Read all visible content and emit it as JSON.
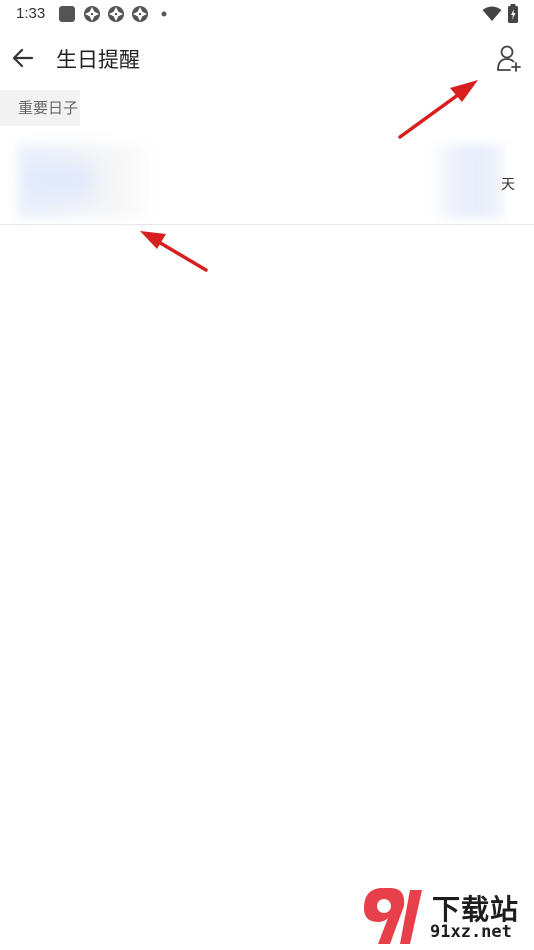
{
  "status_bar": {
    "time": "1:33",
    "notification_icons": [
      "square-icon",
      "aperture-icon",
      "aperture-icon",
      "aperture-icon",
      "dot-icon"
    ],
    "system_icons": [
      "wifi-icon",
      "battery-charging-icon"
    ]
  },
  "app_bar": {
    "title": "生日提醒",
    "back_icon": "arrow-left-icon",
    "add_icon": "person-add-icon"
  },
  "section": {
    "label": "重要日子"
  },
  "event_row": {
    "day_suffix": "天"
  },
  "annotations": {
    "arrow_color": "#d81e1e"
  },
  "watermark": {
    "logo_text": "91",
    "title": "下载站",
    "domain": "91xz.net",
    "accent": "#e8404a"
  }
}
